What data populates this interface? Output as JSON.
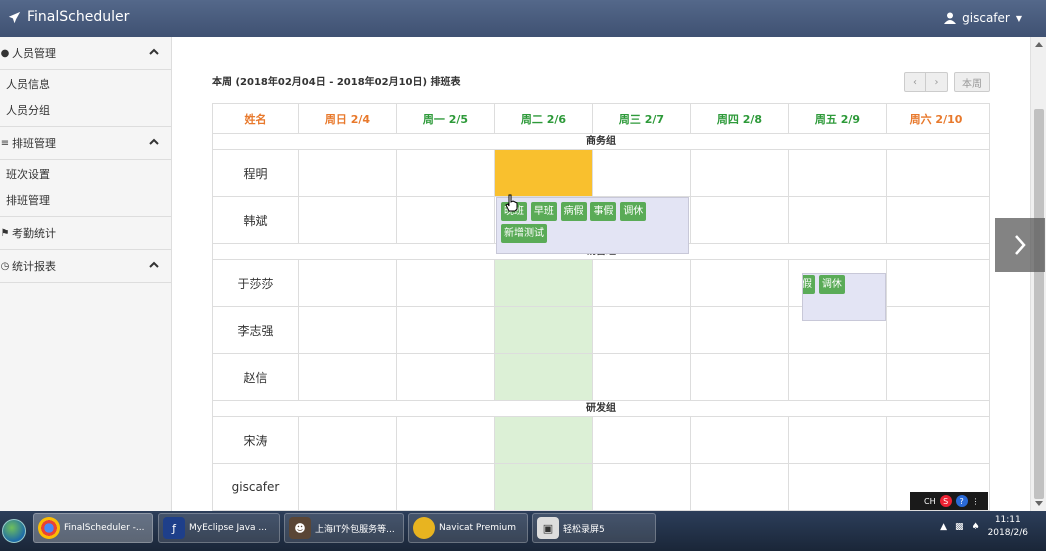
{
  "app": {
    "brand": "FinalScheduler",
    "user": "giscafer"
  },
  "sidebar": {
    "groups": [
      {
        "label": "人员管理",
        "items": [
          "人员信息",
          "人员分组"
        ]
      },
      {
        "label": "排班管理",
        "items": [
          "班次设置",
          "排班管理"
        ]
      },
      {
        "label": "考勤统计",
        "items": []
      },
      {
        "label": "统计报表",
        "items": []
      }
    ]
  },
  "schedule": {
    "title": "本周 (2018年02月04日 - 2018年02月10日) 排班表",
    "prev_label": "‹",
    "next_label": "›",
    "today_label": "本周",
    "headers": [
      "姓名",
      "周日 2/4",
      "周一 2/5",
      "周二 2/6",
      "周三 2/7",
      "周四 2/8",
      "周五 2/9",
      "周六 2/10"
    ],
    "groups": [
      {
        "name": "商务组",
        "members": [
          "程明",
          "韩斌"
        ]
      },
      {
        "name": "销售组",
        "members": [
          "于莎莎",
          "李志强",
          "赵信"
        ]
      },
      {
        "name": "研发组",
        "members": [
          "宋涛",
          "giscafer"
        ]
      }
    ],
    "shift_options": [
      "晚班",
      "早班",
      "病假",
      "事假",
      "调休",
      "新增测试"
    ],
    "popover2_options": [
      "事假",
      "调休"
    ]
  },
  "ime": {
    "lang": "CH"
  },
  "taskbar": {
    "tasks": [
      "FinalScheduler -...",
      "MyEclipse Java ...",
      "上海IT外包服务等...",
      "Navicat Premium",
      "轻松录屏5"
    ],
    "time": "11:11",
    "date": "2018/2/6"
  }
}
